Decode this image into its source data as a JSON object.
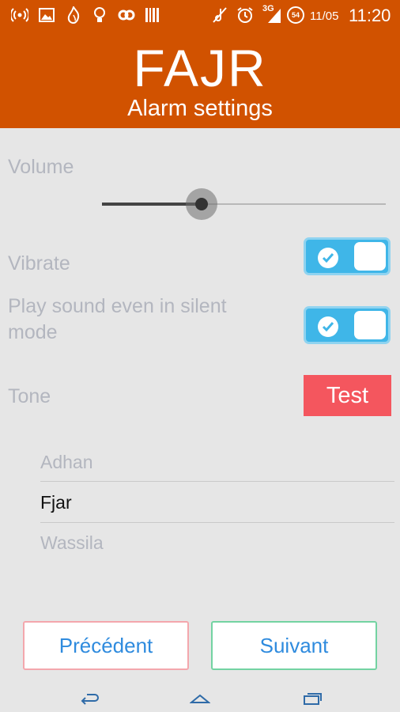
{
  "status_bar": {
    "date": "11/05",
    "time": "11:20",
    "network_label": "3G",
    "battery_level": "54",
    "icons": [
      "wifi-hotspot-icon",
      "image-icon",
      "app-flame-icon",
      "bulb-icon",
      "link-icon",
      "barcode-icon",
      "mute-icon",
      "alarm-icon",
      "signal-icon",
      "battery-icon"
    ]
  },
  "header": {
    "title": "FAJR",
    "subtitle": "Alarm settings",
    "color": "#d15200"
  },
  "volume": {
    "label": "Volume",
    "level": 0.35
  },
  "vibrate": {
    "label": "Vibrate",
    "enabled": true
  },
  "silent_mode": {
    "label": "Play sound even in silent mode",
    "enabled": true
  },
  "tone": {
    "label": "Tone",
    "test_label": "Test",
    "options": [
      "Adhan",
      "Fjar",
      "Wassila"
    ],
    "selected": "Fjar"
  },
  "footer": {
    "previous_label": "Précédent",
    "next_label": "Suivant"
  },
  "colors": {
    "accent": "#d15200",
    "toggle": "#3fb6e8",
    "test_button": "#f4565e",
    "link_text": "#2f8bde"
  }
}
